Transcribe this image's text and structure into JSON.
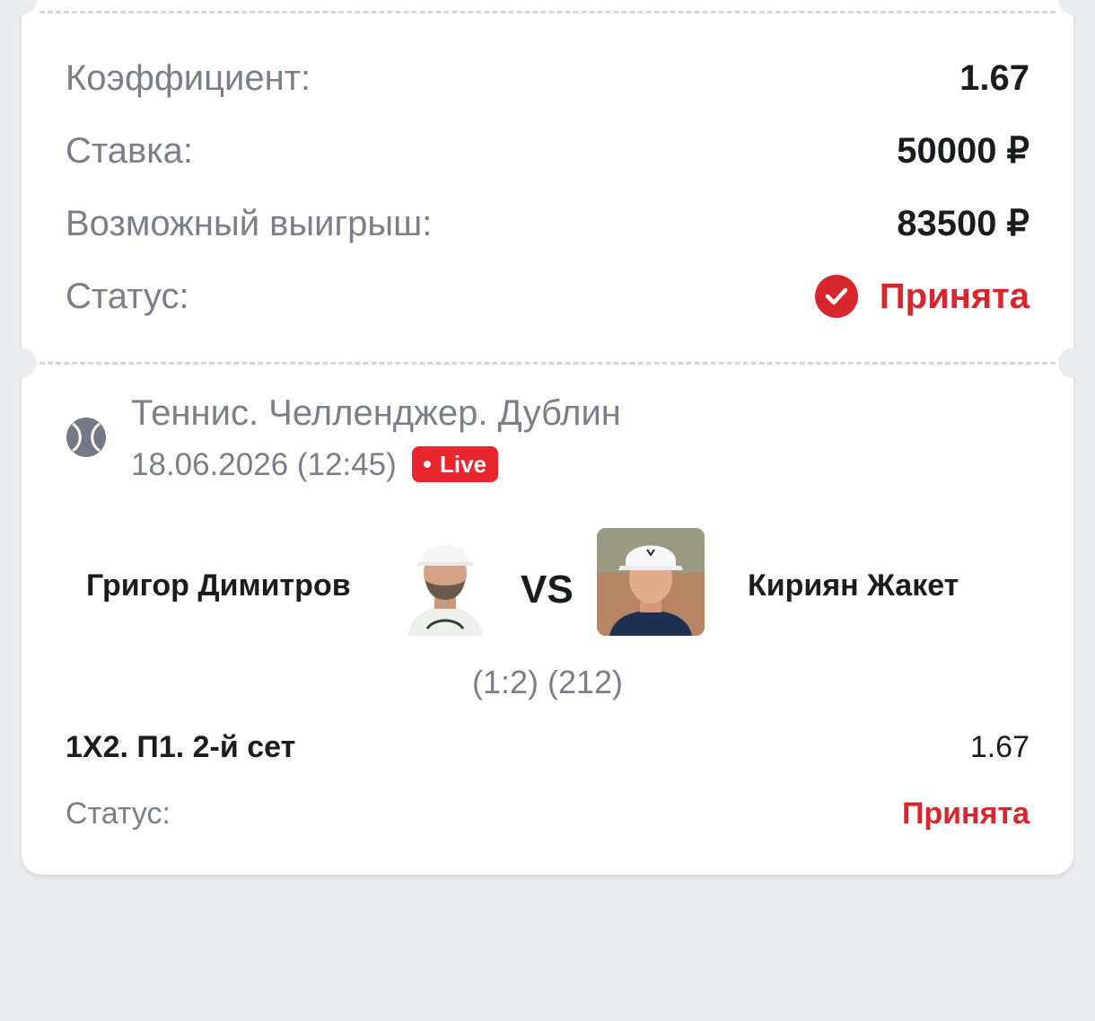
{
  "summary": {
    "coefficient_label": "Коэффициент:",
    "coefficient_value": "1.67",
    "stake_label": "Ставка:",
    "stake_value": "50000 ₽",
    "payout_label": "Возможный выигрыш:",
    "payout_value": "83500 ₽",
    "status_label": "Статус:",
    "status_value": "Принята",
    "status_icon": "check-circle-icon"
  },
  "event": {
    "sport_icon": "tennis-ball-icon",
    "league": "Теннис. Челленджер. Дублин",
    "datetime": "18.06.2026 (12:45)",
    "live_label": "Live",
    "player1": "Григор Димитров",
    "player2": "Кириян Жакет",
    "vs_label": "VS",
    "score": "(1:2) (212)"
  },
  "bet": {
    "market": "1X2. П1. 2-й сет",
    "odds": "1.67",
    "status_label": "Статус:",
    "status_value": "Принята"
  },
  "colors": {
    "accent_red": "#d8262e",
    "live_red": "#e8262d",
    "text_dark": "#1b1c1f",
    "text_muted": "#7b7f88",
    "background": "#ecedf0"
  }
}
